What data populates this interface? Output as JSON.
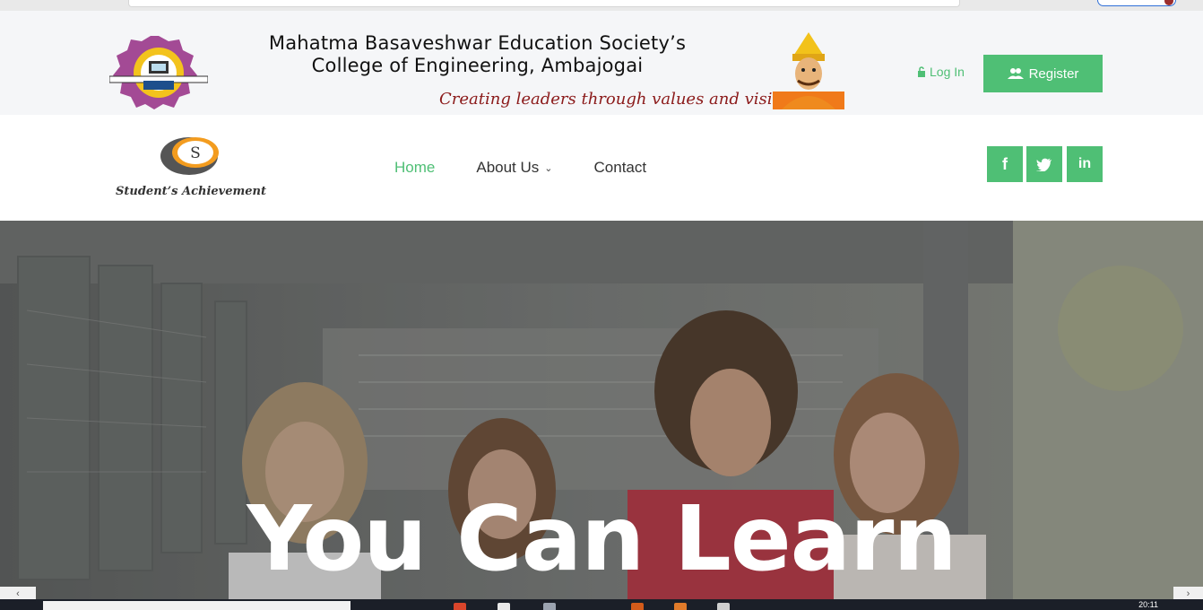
{
  "header": {
    "college_name_line1": "Mahatma Basaveshwar Education Society’s",
    "college_name_line2": "College of Engineering, Ambajogai",
    "tagline": "Creating leaders through values and vision...",
    "login_label": "Log In",
    "register_label": "Register"
  },
  "navbar": {
    "brand": "Student’s Achievement",
    "logo_letter": "S",
    "items": [
      {
        "label": "Home"
      },
      {
        "label": "About Us"
      },
      {
        "label": "Contact"
      }
    ],
    "social": [
      "f",
      "t",
      "in"
    ]
  },
  "hero": {
    "title": "You Can Learn"
  },
  "taskbar": {
    "time": "20:11"
  },
  "colors": {
    "accent": "#4fbf75",
    "tagline": "#8b1a1a"
  }
}
